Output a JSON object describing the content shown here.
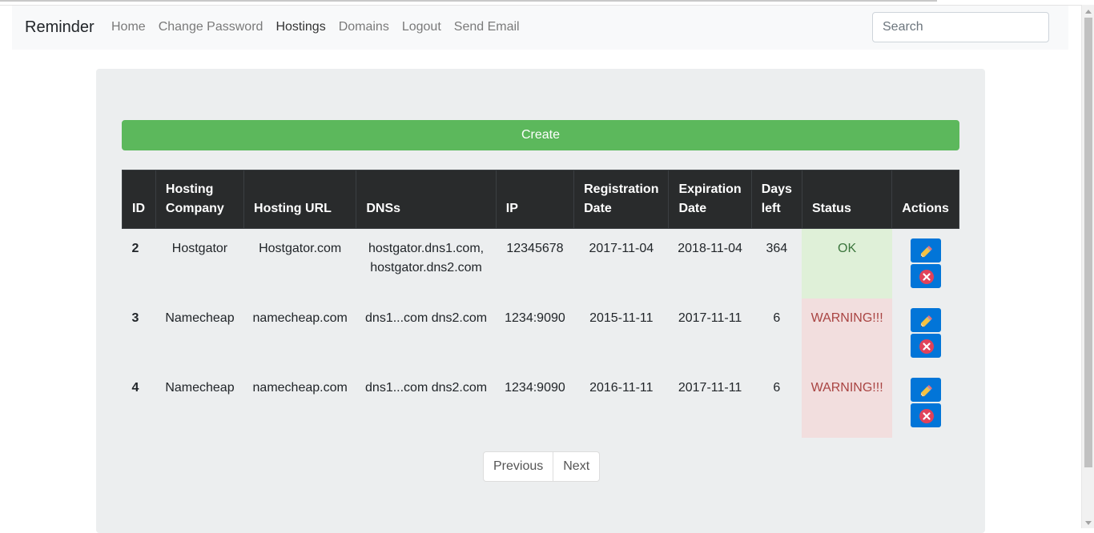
{
  "navbar": {
    "brand": "Reminder",
    "links": [
      "Home",
      "Change Password",
      "Hostings",
      "Domains",
      "Logout",
      "Send Email"
    ],
    "active": "Hostings",
    "search_placeholder": "Search"
  },
  "create_label": "Create",
  "table": {
    "headers": [
      "ID",
      "Hosting Company",
      "Hosting URL",
      "DNSs",
      "IP",
      "Registration Date",
      "Expiration Date",
      "Days left",
      "Status",
      "Actions"
    ],
    "rows": [
      {
        "id": "2",
        "company": "Hostgator",
        "url": "Hostgator.com",
        "dns": "hostgator.dns1.com, hostgator.dns2.com",
        "ip": "12345678",
        "reg": "2017-11-04",
        "exp": "2018-11-04",
        "days": "364",
        "status": "OK",
        "status_type": "ok"
      },
      {
        "id": "3",
        "company": "Namecheap",
        "url": "namecheap.com",
        "dns": "dns1...com dns2.com",
        "ip": "1234:9090",
        "reg": "2015-11-11",
        "exp": "2017-11-11",
        "days": "6",
        "status": "WARNING!!!",
        "status_type": "warning"
      },
      {
        "id": "4",
        "company": "Namecheap",
        "url": "namecheap.com",
        "dns": "dns1...com dns2.com",
        "ip": "1234:9090",
        "reg": "2016-11-11",
        "exp": "2017-11-11",
        "days": "6",
        "status": "WARNING!!!",
        "status_type": "warning"
      }
    ],
    "row_actions": [
      "pencil-icon",
      "delete-icon"
    ]
  },
  "pagination": {
    "previous": "Previous",
    "next": "Next"
  },
  "colors": {
    "create": "#5cb85c",
    "table_header": "#292b2c",
    "status_ok_bg": "#dff0d8",
    "status_ok_text": "#3c763d",
    "status_warning_bg": "#f2dede",
    "status_warning_text": "#a94442",
    "action_button": "#0275d8"
  }
}
